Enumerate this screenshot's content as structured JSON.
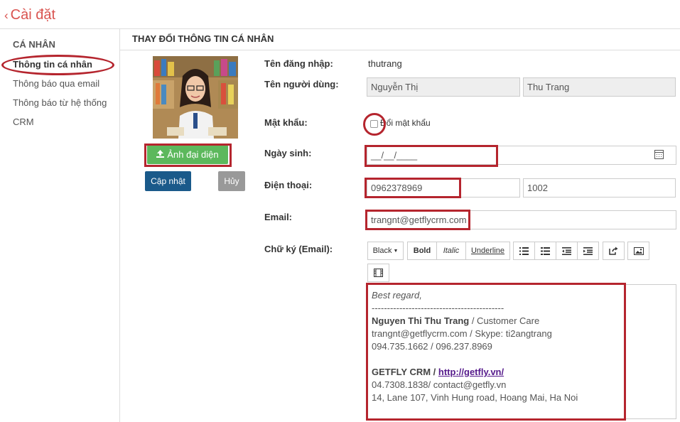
{
  "header": {
    "back_arrow": "‹",
    "title": "Cài đặt"
  },
  "sidebar": {
    "heading": "CÁ NHÂN",
    "items": [
      {
        "label": "Thông tin cá nhân",
        "active": true
      },
      {
        "label": "Thông báo qua email"
      },
      {
        "label": "Thông báo từ hệ thống"
      },
      {
        "label": "CRM"
      }
    ]
  },
  "section": {
    "title": "THAY ĐỔI THÔNG TIN CÁ NHÂN"
  },
  "profile": {
    "avatar_icon": "user-photo",
    "upload_label": "Ảnh đại diện",
    "save_label": "Cập nhật",
    "cancel_label": "Hủy"
  },
  "form": {
    "username": {
      "label": "Tên đăng nhập:",
      "value": "thutrang"
    },
    "fullname": {
      "label": "Tên người dùng:",
      "first": "Nguyễn Thị",
      "last": "Thu Trang"
    },
    "password": {
      "label": "Mật khẩu:",
      "checkbox_label": "Đổi mật khẩu",
      "checked": false
    },
    "birthday": {
      "label": "Ngày sinh:",
      "value": "__/__/____"
    },
    "phone": {
      "label": "Điện thoại:",
      "value": "0962378969",
      "ext": "1002"
    },
    "email": {
      "label": "Email:",
      "value": "trangnt@getflycrm.com"
    },
    "signature": {
      "label": "Chữ ký (Email):",
      "toolbar": {
        "color": "Black",
        "bold": "Bold",
        "italic": "Italic",
        "underline": "Underline"
      },
      "lines": {
        "greeting": "Best regard,",
        "divider": "-------------------------------------------",
        "name": "Nguyen Thi Thu Trang",
        "role": " / Customer Care",
        "contact": "trangnt@getflycrm.com / Skype: ti2angtrang",
        "phones": "094.735.1662 / 096.237.8969",
        "company": "GETFLY CRM / ",
        "website": "http://getfly.vn/",
        "company_phone": "04.7308.1838/ contact@getfly.vn",
        "address": "14, Lane 107, Vinh Hung road, Hoang Mai, Ha Noi"
      }
    }
  },
  "colors": {
    "brand_red": "#d9534f",
    "upload_green": "#5cb85c",
    "save_blue": "#1a5a8a",
    "annotation_red": "#b5252e"
  }
}
